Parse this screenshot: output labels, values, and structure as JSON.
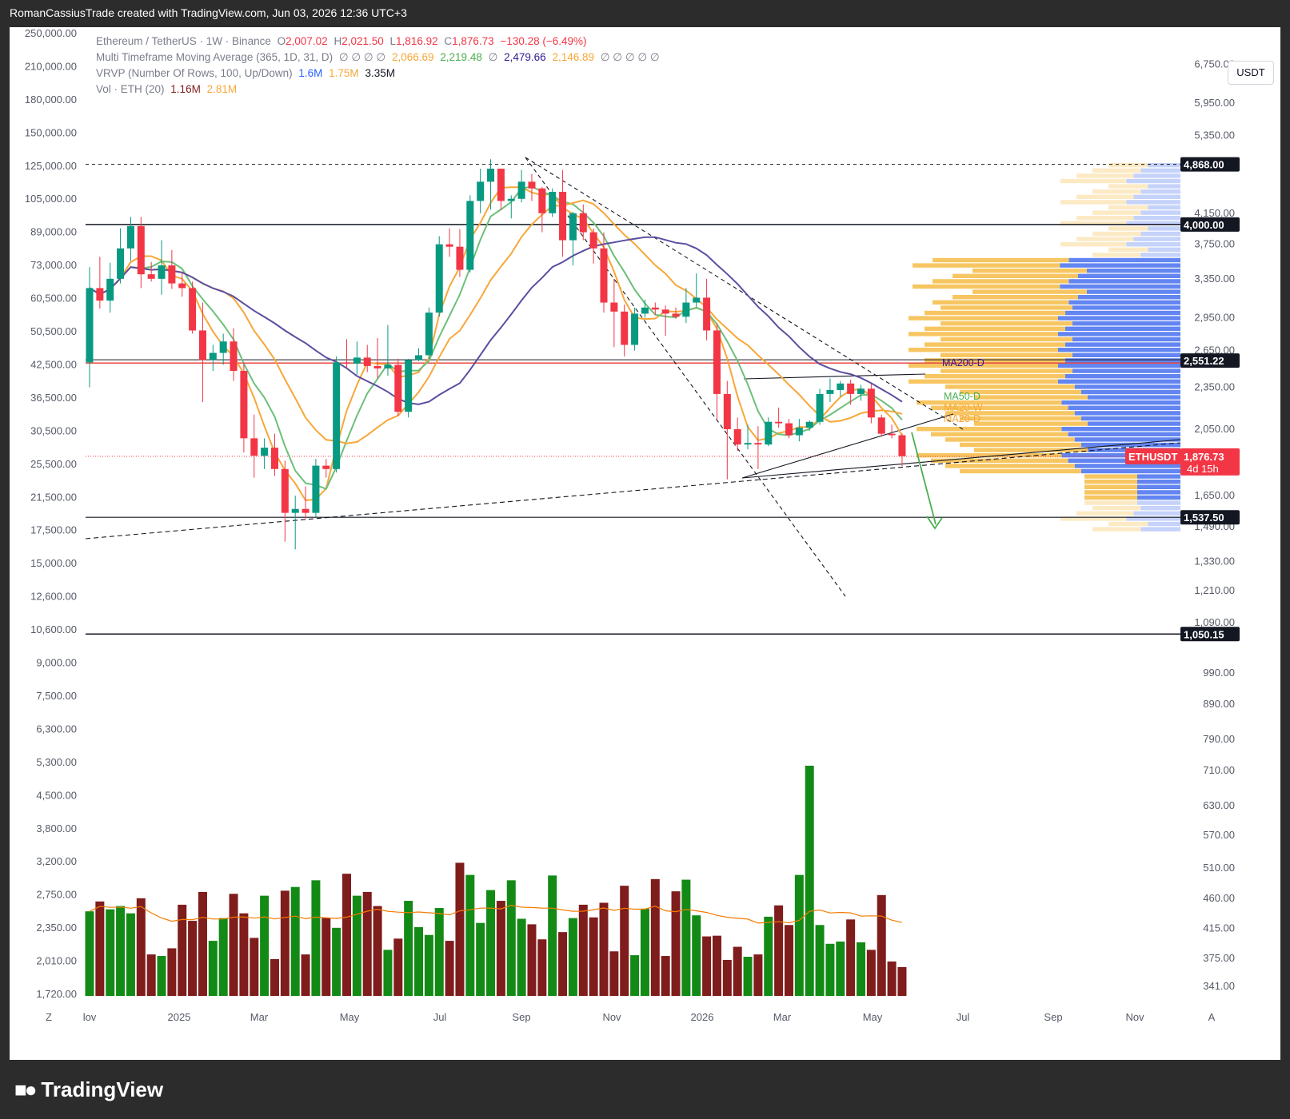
{
  "header": {
    "title": "RomanCassiusTrade created with TradingView.com, Jun 03, 2026 12:36 UTC+3"
  },
  "legend": {
    "symbol": "Ethereum / TetherUS · 1W · Binance",
    "ohlc": {
      "o_label": "O",
      "o": "2,007.02",
      "h_label": "H",
      "h": "2,021.50",
      "l_label": "L",
      "l": "1,816.92",
      "c_label": "C",
      "c": "1,876.73",
      "chg": "−130.28 (−6.49%)"
    },
    "mtma": {
      "label": "Multi Timeframe Moving Average (365, 1D, 31, D)",
      "v1": "∅ ∅ ∅ ∅",
      "v2": "2,066.69",
      "v3": "2,219.48",
      "v4": "∅",
      "v5": "2,479.66",
      "v6": "2,146.89",
      "v7": "∅ ∅ ∅ ∅ ∅"
    },
    "vrvp": {
      "label": "VRVP (Number Of Rows, 100, Up/Down)",
      "up": "1.6M",
      "down": "1.75M",
      "total": "3.35M"
    },
    "vol": {
      "label": "Vol · ETH (20)",
      "v": "1.16M",
      "ma": "2.81M"
    }
  },
  "currency": "USDT",
  "ma_labels": {
    "ma200d": "MA200-D",
    "ma50d": "MA50-D",
    "ma20w": "MA20-W",
    "ma20d": "MA20-D"
  },
  "price_tags": {
    "p4868": "4,868.00",
    "p4000": "4,000.00",
    "p2551": "2,551.22",
    "p1876": "1,876.73",
    "symbol": "ETHUSDT",
    "countdown": "4d 15h",
    "p1537": "1,537.50",
    "p1050": "1,050.15"
  },
  "left_axis_ticks": [
    "250,000.00",
    "210,000.00",
    "180,000.00",
    "150,000.00",
    "125,000.00",
    "105,000.00",
    "89,000.00",
    "73,000.00",
    "60,500.00",
    "50,500.00",
    "42,500.00",
    "36,500.00",
    "30,500.00",
    "25,500.00",
    "21,500.00",
    "17,500.00",
    "15,000.00",
    "12,600.00",
    "10,600.00",
    "9,000.00",
    "7,500.00",
    "6,300.00",
    "5,300.00",
    "4,500.00",
    "3,800.00",
    "3,200.00",
    "2,750.00",
    "2,350.00",
    "2,010.00",
    "1,720.00"
  ],
  "right_axis_ticks": [
    "6,750.00",
    "5,950.00",
    "5,350.00",
    "4,150.00",
    "3,750.00",
    "3,350.00",
    "2,950.00",
    "2,650.00",
    "2,350.00",
    "2,050.00",
    "1,650.00",
    "1,490.00",
    "1,330.00",
    "1,210.00",
    "1,090.00",
    "990.00",
    "890.00",
    "790.00",
    "710.00",
    "630.00",
    "570.00",
    "510.00",
    "460.00",
    "415.00",
    "375.00",
    "341.00"
  ],
  "x_axis_ticks": [
    "lov",
    "2025",
    "Mar",
    "May",
    "Jul",
    "Sep",
    "Nov",
    "2026",
    "Mar",
    "May",
    "Jul",
    "Sep",
    "Nov"
  ],
  "axis_buttons": {
    "zoom": "Z",
    "auto": "A"
  },
  "brand": "TradingView",
  "colors": {
    "up": "#089981",
    "down": "#f23645",
    "vol_up": "#138a16",
    "vol_down": "#7f1c1c",
    "ma_orange": "#f7a737",
    "ma_green": "#6dbf7a",
    "ma_purple": "#5b4ea0",
    "vp_up": "#5a7ef0",
    "vp_down": "#f7c35a",
    "red_line": "#e53935"
  },
  "chart_data": {
    "type": "candlestick",
    "interval": "1W",
    "scale": "log",
    "y_range": [
      1000,
      6900
    ],
    "key_levels": [
      4868.0,
      4000.0,
      2551.22,
      1537.5,
      1050.15
    ],
    "last_close": 1876.73,
    "weekly_ohlc": [
      {
        "o": 2550,
        "h": 3480,
        "l": 2350,
        "c": 3250
      },
      {
        "o": 3250,
        "h": 3600,
        "l": 3040,
        "c": 3120
      },
      {
        "o": 3120,
        "h": 3530,
        "l": 3000,
        "c": 3350
      },
      {
        "o": 3350,
        "h": 3950,
        "l": 3300,
        "c": 3700
      },
      {
        "o": 3700,
        "h": 4100,
        "l": 3550,
        "c": 3980
      },
      {
        "o": 3980,
        "h": 4100,
        "l": 3250,
        "c": 3400
      },
      {
        "o": 3400,
        "h": 3540,
        "l": 3320,
        "c": 3350
      },
      {
        "o": 3350,
        "h": 3800,
        "l": 3180,
        "c": 3500
      },
      {
        "o": 3500,
        "h": 3680,
        "l": 3240,
        "c": 3300
      },
      {
        "o": 3300,
        "h": 3420,
        "l": 3160,
        "c": 3250
      },
      {
        "o": 3250,
        "h": 3320,
        "l": 2800,
        "c": 2830
      },
      {
        "o": 2830,
        "h": 3100,
        "l": 2240,
        "c": 2570
      },
      {
        "o": 2570,
        "h": 2700,
        "l": 2480,
        "c": 2630
      },
      {
        "o": 2630,
        "h": 2800,
        "l": 2530,
        "c": 2730
      },
      {
        "o": 2730,
        "h": 2850,
        "l": 2400,
        "c": 2480
      },
      {
        "o": 2480,
        "h": 2550,
        "l": 1900,
        "c": 1990
      },
      {
        "o": 1990,
        "h": 2150,
        "l": 1750,
        "c": 1880
      },
      {
        "o": 1880,
        "h": 1990,
        "l": 1800,
        "c": 1930
      },
      {
        "o": 1930,
        "h": 2020,
        "l": 1760,
        "c": 1800
      },
      {
        "o": 1800,
        "h": 1850,
        "l": 1420,
        "c": 1560
      },
      {
        "o": 1560,
        "h": 1650,
        "l": 1385,
        "c": 1580
      },
      {
        "o": 1580,
        "h": 1700,
        "l": 1530,
        "c": 1560
      },
      {
        "o": 1560,
        "h": 1860,
        "l": 1540,
        "c": 1820
      },
      {
        "o": 1820,
        "h": 1860,
        "l": 1750,
        "c": 1800
      },
      {
        "o": 1800,
        "h": 2600,
        "l": 1780,
        "c": 2550
      },
      {
        "o": 2550,
        "h": 2750,
        "l": 2500,
        "c": 2540
      },
      {
        "o": 2540,
        "h": 2730,
        "l": 2450,
        "c": 2590
      },
      {
        "o": 2590,
        "h": 2700,
        "l": 2470,
        "c": 2520
      },
      {
        "o": 2520,
        "h": 2760,
        "l": 2420,
        "c": 2500
      },
      {
        "o": 2500,
        "h": 2880,
        "l": 2440,
        "c": 2530
      },
      {
        "o": 2530,
        "h": 2580,
        "l": 2140,
        "c": 2170
      },
      {
        "o": 2170,
        "h": 2580,
        "l": 2130,
        "c": 2570
      },
      {
        "o": 2570,
        "h": 2670,
        "l": 2560,
        "c": 2610
      },
      {
        "o": 2610,
        "h": 3050,
        "l": 2580,
        "c": 3000
      },
      {
        "o": 3000,
        "h": 3850,
        "l": 2960,
        "c": 3750
      },
      {
        "o": 3750,
        "h": 3950,
        "l": 3600,
        "c": 3720
      },
      {
        "o": 3720,
        "h": 3940,
        "l": 3370,
        "c": 3450
      },
      {
        "o": 3450,
        "h": 4400,
        "l": 3420,
        "c": 4320
      },
      {
        "o": 4320,
        "h": 4800,
        "l": 4150,
        "c": 4600
      },
      {
        "o": 4600,
        "h": 4950,
        "l": 4200,
        "c": 4800
      },
      {
        "o": 4800,
        "h": 4800,
        "l": 4200,
        "c": 4320
      },
      {
        "o": 4320,
        "h": 4400,
        "l": 4080,
        "c": 4350
      },
      {
        "o": 4350,
        "h": 4780,
        "l": 4300,
        "c": 4600
      },
      {
        "o": 4600,
        "h": 4720,
        "l": 4320,
        "c": 4500
      },
      {
        "o": 4500,
        "h": 4520,
        "l": 3900,
        "c": 4150
      },
      {
        "o": 4150,
        "h": 4500,
        "l": 4100,
        "c": 4450
      },
      {
        "o": 4450,
        "h": 4780,
        "l": 3600,
        "c": 3800
      },
      {
        "o": 3800,
        "h": 4170,
        "l": 3500,
        "c": 4150
      },
      {
        "o": 4150,
        "h": 4270,
        "l": 3800,
        "c": 3900
      },
      {
        "o": 3900,
        "h": 3950,
        "l": 3520,
        "c": 3700
      },
      {
        "o": 3700,
        "h": 3900,
        "l": 3000,
        "c": 3100
      },
      {
        "o": 3100,
        "h": 3350,
        "l": 2680,
        "c": 3010
      },
      {
        "o": 3010,
        "h": 3080,
        "l": 2600,
        "c": 2700
      },
      {
        "o": 2700,
        "h": 3050,
        "l": 2650,
        "c": 2990
      },
      {
        "o": 2990,
        "h": 3130,
        "l": 2950,
        "c": 3050
      },
      {
        "o": 3050,
        "h": 3100,
        "l": 2980,
        "c": 3030
      },
      {
        "o": 3030,
        "h": 3070,
        "l": 2780,
        "c": 2990
      },
      {
        "o": 2990,
        "h": 3050,
        "l": 2940,
        "c": 2960
      },
      {
        "o": 2960,
        "h": 3250,
        "l": 2900,
        "c": 3100
      },
      {
        "o": 3100,
        "h": 3410,
        "l": 3050,
        "c": 3150
      },
      {
        "o": 3150,
        "h": 3350,
        "l": 2740,
        "c": 2830
      },
      {
        "o": 2830,
        "h": 2900,
        "l": 2110,
        "c": 2300
      },
      {
        "o": 2300,
        "h": 2400,
        "l": 1740,
        "c": 2050
      },
      {
        "o": 2050,
        "h": 2130,
        "l": 1910,
        "c": 1950
      },
      {
        "o": 1950,
        "h": 2080,
        "l": 1920,
        "c": 1960
      },
      {
        "o": 1960,
        "h": 2070,
        "l": 1800,
        "c": 1950
      },
      {
        "o": 1950,
        "h": 2130,
        "l": 1940,
        "c": 2100
      },
      {
        "o": 2100,
        "h": 2200,
        "l": 2060,
        "c": 2090
      },
      {
        "o": 2090,
        "h": 2120,
        "l": 1990,
        "c": 2010
      },
      {
        "o": 2010,
        "h": 2120,
        "l": 1970,
        "c": 2060
      },
      {
        "o": 2060,
        "h": 2110,
        "l": 2040,
        "c": 2100
      },
      {
        "o": 2100,
        "h": 2340,
        "l": 2080,
        "c": 2300
      },
      {
        "o": 2300,
        "h": 2420,
        "l": 2240,
        "c": 2330
      },
      {
        "o": 2330,
        "h": 2400,
        "l": 2280,
        "c": 2380
      },
      {
        "o": 2380,
        "h": 2410,
        "l": 2220,
        "c": 2300
      },
      {
        "o": 2300,
        "h": 2370,
        "l": 2250,
        "c": 2340
      },
      {
        "o": 2340,
        "h": 2380,
        "l": 2090,
        "c": 2130
      },
      {
        "o": 2130,
        "h": 2150,
        "l": 2000,
        "c": 2020
      },
      {
        "o": 2020,
        "h": 2080,
        "l": 1990,
        "c": 2010
      },
      {
        "o": 2010,
        "h": 2021.5,
        "l": 1816.92,
        "c": 1876.73
      }
    ],
    "volume_y_range": [
      330,
      750
    ],
    "weekly_volume": [
      440,
      455,
      443,
      448,
      437,
      460,
      380,
      378,
      388,
      450,
      426,
      470,
      398,
      430,
      467,
      437,
      402,
      464,
      374,
      472,
      478,
      380,
      489,
      430,
      416,
      500,
      464,
      470,
      448,
      386,
      401,
      456,
      417,
      406,
      445,
      398,
      519,
      498,
      423,
      473,
      456,
      489,
      429,
      421,
      400,
      497,
      410,
      430,
      450,
      431,
      453,
      384,
      480,
      379,
      444,
      491,
      378,
      471,
      490,
      434,
      404,
      405,
      373,
      390,
      377,
      380,
      432,
      449,
      420,
      498,
      722,
      420,
      394,
      397,
      428,
      396,
      386,
      465,
      371,
      364
    ]
  }
}
